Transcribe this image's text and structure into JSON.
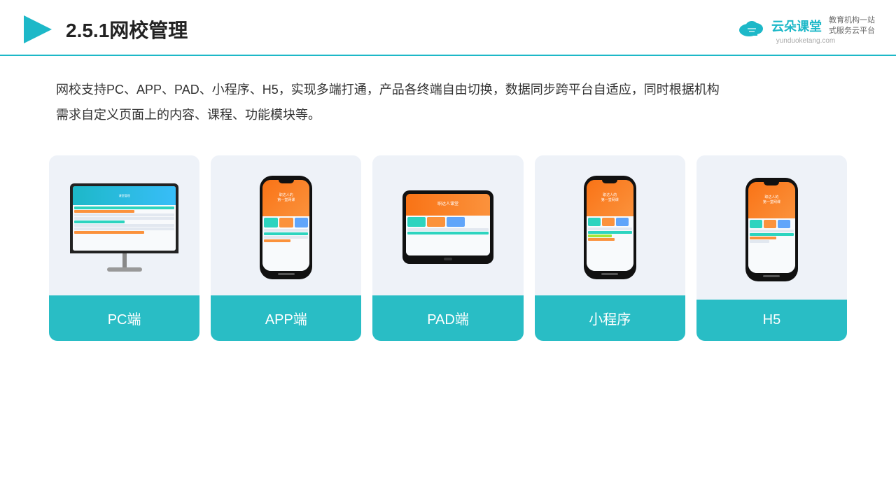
{
  "header": {
    "title": "2.5.1网校管理",
    "logo_name": "云朵课堂",
    "logo_url": "yunduoketang.com",
    "logo_tagline1": "教育机构一站",
    "logo_tagline2": "式服务云平台"
  },
  "description": {
    "text": "网校支持PC、APP、PAD、小程序、H5，实现多端打通，产品各终端自由切换，数据同步跨平台自适应，同时根据机构需求自定义页面上的内容、课程、功能模块等。"
  },
  "cards": [
    {
      "id": "pc",
      "label": "PC端"
    },
    {
      "id": "app",
      "label": "APP端"
    },
    {
      "id": "pad",
      "label": "PAD端"
    },
    {
      "id": "miniprogram",
      "label": "小程序"
    },
    {
      "id": "h5",
      "label": "H5"
    }
  ]
}
